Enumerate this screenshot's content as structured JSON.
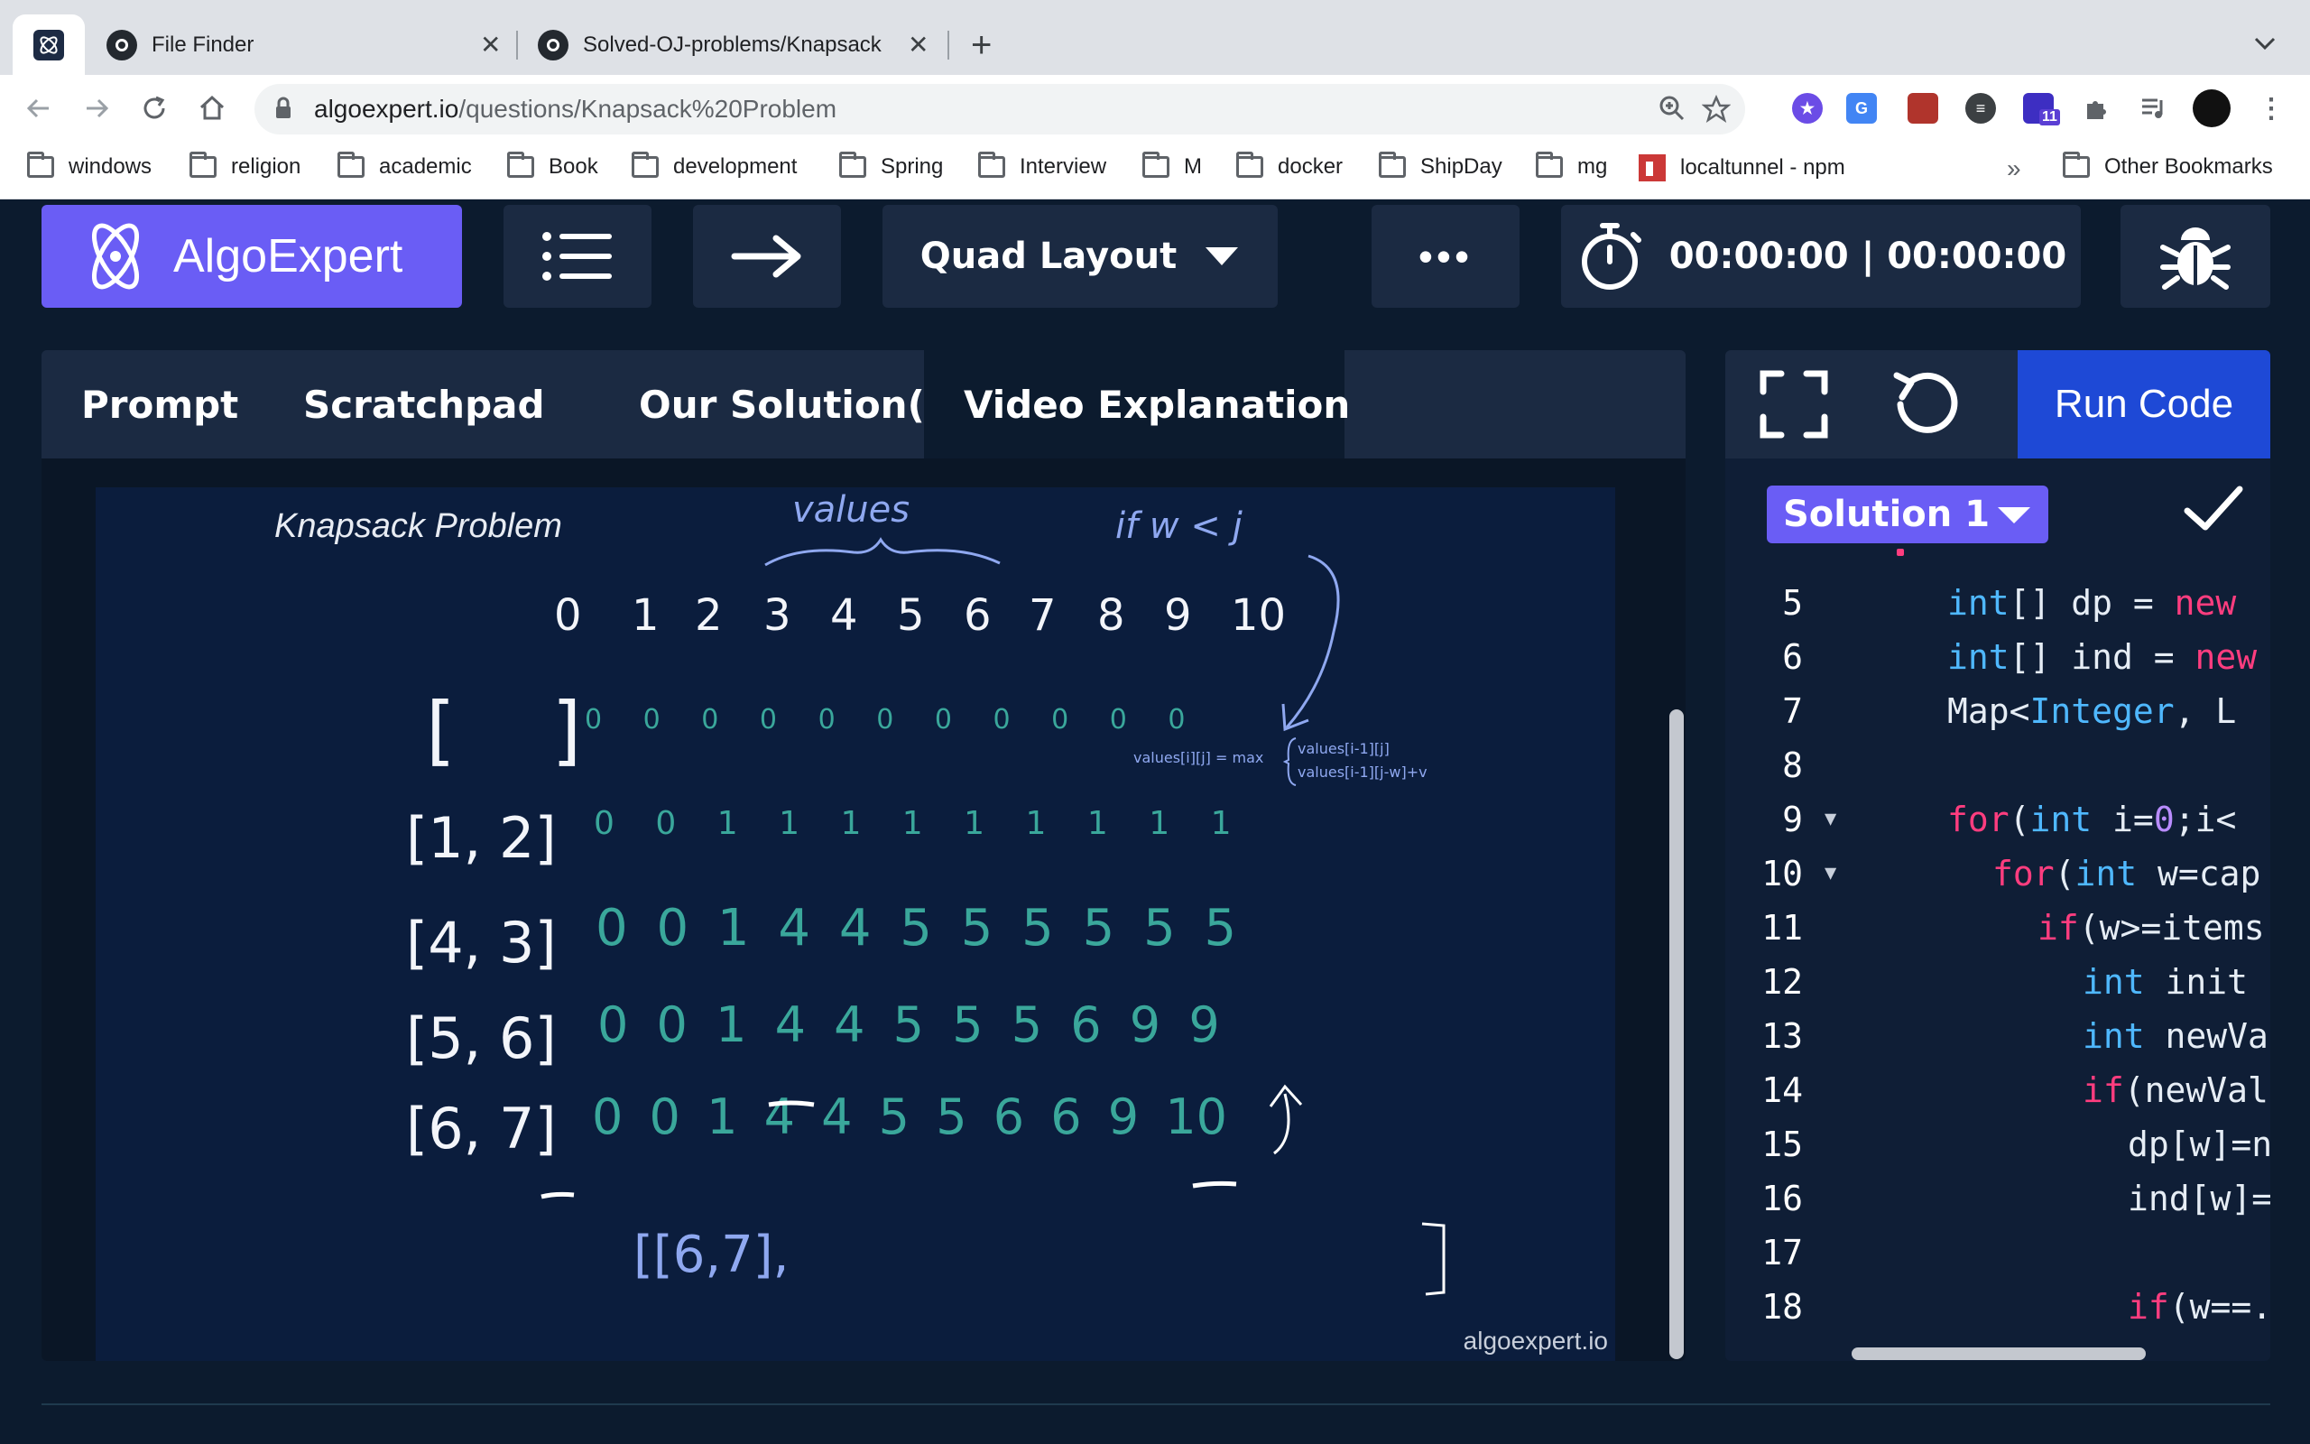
{
  "browser": {
    "tabs": [
      {
        "title": "",
        "favicon": "algoexpert-favicon",
        "active": true
      },
      {
        "title": "File Finder",
        "favicon": "github-icon",
        "active": false
      },
      {
        "title": "Solved-OJ-problems/Knapsack",
        "favicon": "github-icon",
        "active": false
      }
    ],
    "close_glyph": "✕",
    "new_tab_glyph": "+",
    "url_host": "algoexpert.io",
    "url_path": "/questions/Knapsack%20Problem",
    "extension_badge": "11",
    "bookmarks": [
      "windows",
      "religion",
      "academic",
      "Book",
      "development",
      "Spring",
      "Interview",
      "M",
      "docker",
      "ShipDay",
      "mg",
      "localtunnel - npm"
    ],
    "bookmarks_more": "»",
    "other_bookmarks": "Other Bookmarks"
  },
  "app": {
    "logo_text": "AlgoExpert",
    "layout_label": "Quad Layout",
    "more_glyph": "•••",
    "timer": "00:00:00 | 00:00:00",
    "accent_color": "#6a5df5",
    "run_color": "#1e49d6",
    "panel_tabs": [
      "Prompt",
      "Scratchpad",
      "Our Solution(s)",
      "Video Explanation"
    ],
    "active_tab": "Video Explanation"
  },
  "video": {
    "title": "Knapsack Problem",
    "watermark": "algoexpert.io",
    "annotations": {
      "values_label": "values",
      "condition": "if w < j",
      "header_numbers": [
        "0",
        "1",
        "2",
        "3",
        "4",
        "5",
        "6",
        "7",
        "8",
        "9",
        "10"
      ],
      "formula_left": "values[i][j] = max",
      "formula_a": "values[i-1][j]",
      "formula_b": "values[i-1][j-w]+v",
      "result_text": "[[6,7],"
    },
    "rows": [
      {
        "item": "[ ]",
        "values": [
          "0",
          "0",
          "0",
          "0",
          "0",
          "0",
          "0",
          "0",
          "0",
          "0",
          "0"
        ]
      },
      {
        "item": "[1, 2]",
        "values": [
          "0",
          "0",
          "1",
          "1",
          "1",
          "1",
          "1",
          "1",
          "1",
          "1",
          "1"
        ]
      },
      {
        "item": "[4, 3]",
        "values": [
          "0",
          "0",
          "1",
          "4",
          "4",
          "5",
          "5",
          "5",
          "5",
          "5",
          "5"
        ]
      },
      {
        "item": "[5, 6]",
        "values": [
          "0",
          "0",
          "1",
          "4",
          "4",
          "5",
          "5",
          "5",
          "6",
          "9",
          "9"
        ]
      },
      {
        "item": "[6, 7]",
        "values": [
          "0",
          "0",
          "1",
          "4",
          "4",
          "5",
          "5",
          "6",
          "6",
          "9",
          "10"
        ]
      }
    ]
  },
  "editor": {
    "run_label": "Run Code",
    "solution_label": "Solution 1",
    "lines": [
      {
        "n": "5",
        "fold": false
      },
      {
        "n": "6",
        "fold": false
      },
      {
        "n": "7",
        "fold": false
      },
      {
        "n": "8",
        "fold": false
      },
      {
        "n": "9",
        "fold": true
      },
      {
        "n": "10",
        "fold": true
      },
      {
        "n": "11",
        "fold": false
      },
      {
        "n": "12",
        "fold": false
      },
      {
        "n": "13",
        "fold": false
      },
      {
        "n": "14",
        "fold": false
      },
      {
        "n": "15",
        "fold": false
      },
      {
        "n": "16",
        "fold": false
      },
      {
        "n": "17",
        "fold": false
      },
      {
        "n": "18",
        "fold": false
      }
    ],
    "code": {
      "l5": [
        "int",
        "[] dp = ",
        "new"
      ],
      "l6": [
        "int",
        "[] ind = ",
        "new"
      ],
      "l7": [
        "Map<",
        "Integer",
        ", L"
      ],
      "l9": [
        "for",
        "(",
        "int",
        " i=",
        "0",
        ";i<"
      ],
      "l10": [
        "for",
        "(",
        "int",
        " w=cap"
      ],
      "l11": [
        "if",
        "(w>=items"
      ],
      "l12": [
        "int",
        " init"
      ],
      "l13": [
        "int",
        " newVa"
      ],
      "l14": [
        "if",
        "(newVal"
      ],
      "l15": [
        "dp[w]=n"
      ],
      "l16": [
        "ind[w]="
      ],
      "l18": [
        "if",
        "(w==."
      ]
    },
    "fold_glyph": "▼"
  }
}
